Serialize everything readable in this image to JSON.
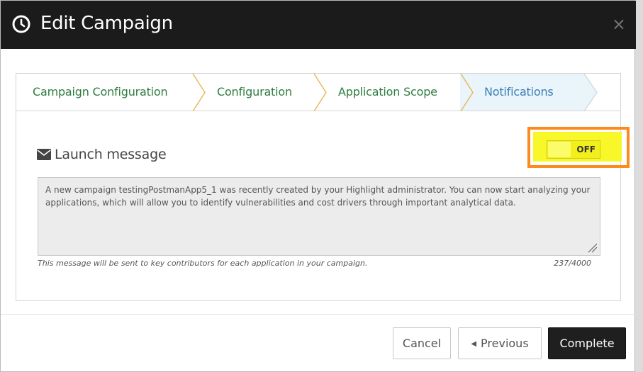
{
  "header": {
    "title": "Edit Campaign",
    "close_glyph": "×",
    "icon": "clock-icon"
  },
  "steps": [
    {
      "label": "Campaign Configuration",
      "active": false
    },
    {
      "label": "Configuration",
      "active": false
    },
    {
      "label": "Application Scope",
      "active": false
    },
    {
      "label": "Notifications",
      "active": true
    }
  ],
  "launch": {
    "icon": "envelope-icon",
    "label": "Launch message",
    "toggle_state": "OFF",
    "message": "A new campaign testingPostmanApp5_1 was recently created by your Highlight administrator. You can now start analyzing your applications, which will allow you to identify vulnerabilities and cost drivers through important analytical data.",
    "hint": "This message will be sent to key contributors for each application in your campaign.",
    "counter": "237/4000"
  },
  "footer": {
    "cancel": "Cancel",
    "previous": "Previous",
    "complete": "Complete"
  },
  "colors": {
    "header_bg": "#1b1b1b",
    "step_text": "#2e7d40",
    "step_active_text": "#3b7db5",
    "highlight_border": "#ff8a1c",
    "highlight_fill": "#f7f72a",
    "complete_bg": "#1f1f1f"
  }
}
